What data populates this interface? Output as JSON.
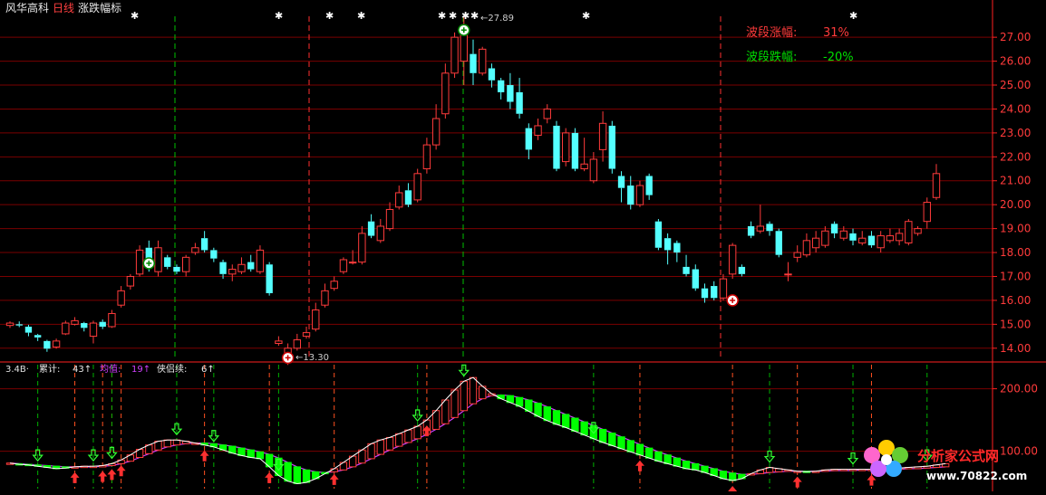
{
  "header": {
    "stock_name": "风华高科",
    "period": "日线",
    "indicator": "涨跌幅标"
  },
  "wave_box": {
    "up_label": "波段涨幅:",
    "up_value": "31%",
    "down_label": "波段跌幅:",
    "down_value": "-20%"
  },
  "annotations": {
    "high": "←27.89",
    "low": "←13.30"
  },
  "sub_header": {
    "prefix": "3.4B·",
    "items": [
      {
        "label": "累计:",
        "value": "43↑"
      },
      {
        "label": "均值:",
        "value": "19↑"
      },
      {
        "label": "侠侣续:",
        "value": "6↑"
      }
    ]
  },
  "watermark": {
    "brand": "分析家公式网",
    "url": "www.70822.com"
  },
  "colors": {
    "up": "#ff3b3b",
    "down": "#54ffff",
    "grid": "#7a0000",
    "axis": "#ff2020",
    "green": "#00ff00",
    "purple": "#d040ff"
  },
  "chart_data": [
    {
      "type": "candlestick",
      "title": "风华高科 日线",
      "ylim": [
        13.5,
        27.8
      ],
      "yticks": [
        14.0,
        15.0,
        16.0,
        17.0,
        18.0,
        19.0,
        20.0,
        21.0,
        22.0,
        23.0,
        24.0,
        25.0,
        26.0,
        27.0
      ],
      "candles": [
        [
          14.95,
          15.05,
          15.12,
          14.85
        ],
        [
          15.0,
          14.95,
          15.12,
          14.88
        ],
        [
          14.9,
          14.65,
          14.98,
          14.5
        ],
        [
          14.55,
          14.45,
          14.6,
          14.3
        ],
        [
          14.3,
          13.98,
          14.35,
          13.85
        ],
        [
          14.05,
          14.3,
          14.4,
          13.98
        ],
        [
          14.6,
          15.05,
          15.15,
          14.55
        ],
        [
          15.0,
          15.15,
          15.3,
          14.95
        ],
        [
          15.05,
          14.85,
          15.1,
          14.7
        ],
        [
          14.5,
          15.05,
          15.15,
          14.2
        ],
        [
          15.1,
          14.9,
          15.2,
          14.8
        ],
        [
          14.9,
          15.45,
          15.6,
          14.85
        ],
        [
          15.8,
          16.4,
          16.6,
          15.7
        ],
        [
          16.6,
          17.0,
          17.1,
          16.45
        ],
        [
          17.1,
          18.1,
          18.3,
          17.0
        ],
        [
          18.2,
          17.5,
          18.5,
          17.2
        ],
        [
          17.2,
          18.2,
          18.5,
          17.0
        ],
        [
          17.8,
          17.4,
          17.9,
          17.3
        ],
        [
          17.4,
          17.2,
          17.5,
          17.1
        ],
        [
          17.2,
          17.8,
          17.9,
          17.0
        ],
        [
          18.0,
          18.2,
          18.4,
          17.9
        ],
        [
          18.6,
          18.1,
          18.9,
          18.0
        ],
        [
          18.1,
          17.75,
          18.2,
          17.6
        ],
        [
          17.6,
          17.1,
          17.7,
          16.9
        ],
        [
          17.1,
          17.3,
          17.5,
          16.8
        ],
        [
          17.2,
          17.5,
          17.8,
          17.1
        ],
        [
          17.6,
          17.3,
          17.9,
          17.2
        ],
        [
          17.2,
          18.1,
          18.3,
          17.1
        ],
        [
          17.5,
          16.3,
          17.6,
          16.2
        ],
        [
          14.2,
          14.3,
          14.5,
          14.1
        ],
        [
          13.4,
          14.0,
          14.2,
          13.3
        ],
        [
          14.0,
          14.35,
          14.6,
          13.9
        ],
        [
          14.5,
          14.65,
          14.9,
          14.4
        ],
        [
          14.8,
          15.6,
          15.9,
          14.7
        ],
        [
          15.8,
          16.4,
          16.7,
          15.7
        ],
        [
          16.5,
          16.8,
          17.0,
          16.4
        ],
        [
          17.2,
          17.7,
          17.8,
          17.1
        ],
        [
          17.6,
          17.6,
          18.1,
          17.5
        ],
        [
          17.6,
          18.8,
          19.1,
          17.5
        ],
        [
          19.3,
          18.7,
          19.6,
          18.6
        ],
        [
          18.5,
          19.1,
          19.4,
          18.4
        ],
        [
          19.0,
          19.8,
          20.1,
          18.9
        ],
        [
          19.9,
          20.5,
          20.8,
          19.8
        ],
        [
          20.6,
          20.0,
          20.9,
          19.9
        ],
        [
          20.2,
          21.3,
          21.5,
          20.1
        ],
        [
          21.5,
          22.5,
          22.8,
          21.3
        ],
        [
          22.5,
          23.6,
          24.2,
          22.3
        ],
        [
          23.8,
          25.5,
          25.9,
          23.6
        ],
        [
          25.5,
          27.0,
          27.2,
          25.3
        ],
        [
          26.0,
          27.3,
          27.9,
          25.0
        ],
        [
          26.3,
          25.5,
          26.9,
          25.0
        ],
        [
          25.5,
          26.5,
          26.6,
          25.4
        ],
        [
          25.7,
          25.2,
          25.9,
          24.9
        ],
        [
          25.2,
          24.7,
          25.3,
          24.4
        ],
        [
          25.0,
          24.3,
          25.5,
          24.0
        ],
        [
          24.7,
          23.8,
          25.3,
          23.6
        ],
        [
          23.2,
          22.3,
          23.4,
          21.9
        ],
        [
          22.9,
          23.3,
          23.6,
          22.7
        ],
        [
          23.6,
          24.0,
          24.2,
          23.4
        ],
        [
          23.3,
          21.5,
          23.5,
          21.4
        ],
        [
          21.8,
          23.0,
          23.2,
          21.6
        ],
        [
          23.0,
          21.5,
          23.2,
          21.4
        ],
        [
          21.5,
          21.7,
          22.8,
          21.4
        ],
        [
          21.0,
          21.9,
          22.2,
          20.9
        ],
        [
          22.3,
          23.4,
          23.9,
          21.8
        ],
        [
          23.3,
          21.5,
          23.5,
          21.3
        ],
        [
          21.2,
          20.7,
          21.4,
          20.1
        ],
        [
          20.8,
          20.0,
          21.2,
          19.8
        ],
        [
          20.0,
          20.8,
          21.0,
          19.9
        ],
        [
          21.2,
          20.4,
          21.3,
          20.2
        ],
        [
          19.3,
          18.2,
          19.4,
          18.1
        ],
        [
          18.6,
          18.1,
          18.8,
          17.5
        ],
        [
          18.4,
          18.0,
          18.5,
          17.6
        ],
        [
          17.4,
          17.1,
          17.9,
          17.0
        ],
        [
          17.3,
          16.5,
          17.5,
          16.4
        ],
        [
          16.5,
          16.1,
          16.7,
          15.9
        ],
        [
          16.6,
          16.1,
          16.8,
          16.0
        ],
        [
          16.1,
          16.9,
          17.1,
          16.0
        ],
        [
          17.1,
          18.3,
          18.4,
          16.9
        ],
        [
          17.4,
          17.1,
          17.5,
          17.0
        ],
        [
          19.1,
          18.7,
          19.3,
          18.6
        ],
        [
          18.9,
          19.1,
          20.0,
          18.8
        ],
        [
          19.2,
          18.9,
          19.3,
          18.7
        ],
        [
          18.9,
          17.9,
          19.0,
          17.8
        ],
        [
          17.1,
          17.1,
          17.6,
          16.8
        ],
        [
          17.8,
          18.0,
          18.3,
          17.6
        ],
        [
          17.9,
          18.5,
          18.8,
          17.8
        ],
        [
          18.2,
          18.6,
          18.9,
          18.0
        ],
        [
          18.3,
          18.9,
          19.1,
          18.2
        ],
        [
          19.2,
          18.8,
          19.3,
          18.6
        ],
        [
          18.6,
          18.9,
          19.1,
          18.5
        ],
        [
          18.8,
          18.5,
          19.0,
          18.3
        ],
        [
          18.4,
          18.6,
          18.9,
          18.3
        ],
        [
          18.7,
          18.3,
          18.9,
          18.2
        ],
        [
          18.2,
          18.7,
          18.9,
          18.0
        ],
        [
          18.5,
          18.7,
          19.0,
          18.4
        ],
        [
          18.5,
          18.8,
          19.0,
          18.3
        ],
        [
          18.4,
          19.3,
          19.4,
          18.3
        ],
        [
          18.8,
          19.0,
          19.1,
          18.7
        ],
        [
          19.3,
          20.1,
          20.3,
          19.0
        ],
        [
          20.3,
          21.3,
          21.7,
          20.2
        ]
      ],
      "high_label": 27.89,
      "low_label": 13.3
    },
    {
      "type": "line",
      "title": "涨跌幅标 副图",
      "ylim": [
        40,
        240
      ],
      "yticks": [
        100.0,
        200.0
      ],
      "series": [
        {
          "name": "累计",
          "values": [
            81,
            79,
            78,
            76,
            74,
            72,
            73,
            75,
            76,
            76,
            77,
            80,
            86,
            94,
            103,
            110,
            116,
            118,
            118,
            116,
            113,
            110,
            107,
            102,
            97,
            93,
            90,
            88,
            75,
            61,
            52,
            48,
            50,
            56,
            64,
            72,
            82,
            92,
            102,
            112,
            118,
            122,
            128,
            134,
            140,
            150,
            165,
            182,
            198,
            212,
            218,
            204,
            192,
            184,
            178,
            172,
            164,
            156,
            149,
            143,
            138,
            132,
            126,
            120,
            114,
            109,
            104,
            99,
            94,
            89,
            84,
            80,
            76,
            72,
            70,
            66,
            61,
            56,
            53,
            56,
            64,
            70,
            74,
            72,
            70,
            68,
            67,
            68,
            70,
            71,
            71,
            71,
            71,
            71,
            72,
            72,
            73,
            74,
            75,
            76,
            78,
            80
          ]
        },
        {
          "name": "均值",
          "values": [
            81,
            80,
            79,
            78,
            77,
            76,
            75,
            75,
            75,
            75,
            76,
            77,
            80,
            84,
            90,
            96,
            102,
            107,
            110,
            112,
            113,
            113,
            112,
            110,
            108,
            105,
            102,
            99,
            95,
            89,
            82,
            75,
            70,
            67,
            66,
            67,
            70,
            75,
            81,
            88,
            95,
            102,
            108,
            114,
            120,
            127,
            135,
            144,
            154,
            165,
            176,
            184,
            189,
            190,
            189,
            186,
            182,
            177,
            171,
            165,
            159,
            153,
            147,
            141,
            135,
            129,
            123,
            117,
            111,
            105,
            99,
            94,
            89,
            84,
            80,
            76,
            72,
            68,
            65,
            63,
            63,
            64,
            66,
            67,
            68,
            68,
            68,
            68,
            68,
            69,
            69,
            69,
            70,
            70,
            70,
            71,
            71,
            72,
            72,
            73,
            74,
            75
          ]
        }
      ],
      "up_arrows": [
        7,
        10,
        11,
        12,
        21,
        28,
        35,
        45,
        68,
        78,
        85,
        93
      ],
      "down_arrows": [
        3,
        9,
        11,
        18,
        22,
        29,
        44,
        49,
        63,
        82,
        91,
        99
      ]
    }
  ]
}
